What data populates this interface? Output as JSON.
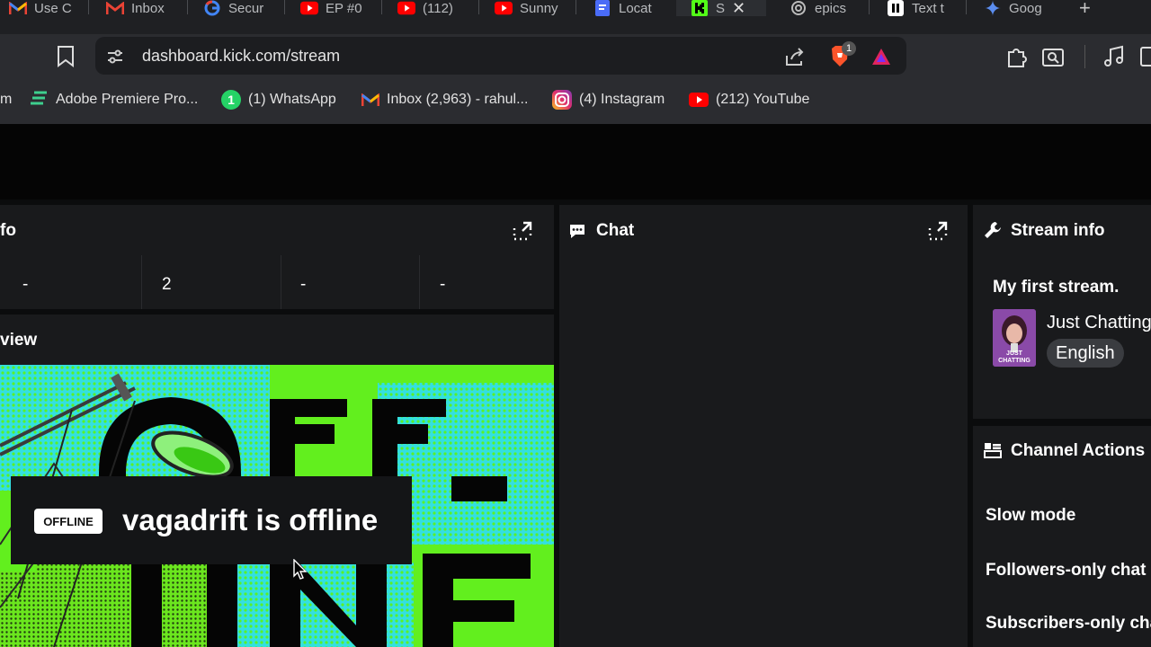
{
  "browser": {
    "tabs": [
      {
        "label": "Use C",
        "icon": "gmail-icon"
      },
      {
        "label": "Inbox",
        "icon": "gmail-icon"
      },
      {
        "label": "Secur",
        "icon": "google-icon"
      },
      {
        "label": "EP #0",
        "icon": "youtube-icon"
      },
      {
        "label": "(112)",
        "icon": "youtube-icon"
      },
      {
        "label": "Sunny",
        "icon": "youtube-icon"
      },
      {
        "label": "Locat",
        "icon": "forms-icon"
      },
      {
        "label": "S",
        "icon": "kick-icon",
        "active": true
      },
      {
        "label": "epics",
        "icon": "openai-icon"
      },
      {
        "label": "Text t",
        "icon": "pause-icon"
      },
      {
        "label": "Goog",
        "icon": "gemini-icon"
      }
    ],
    "url": "dashboard.kick.com/stream",
    "shield_count": "1",
    "bookmarks": [
      {
        "label": "Adobe Premiere Pro...",
        "icon": "premiere-icon"
      },
      {
        "label": "(1) WhatsApp",
        "icon": "whatsapp-icon",
        "badge": "1"
      },
      {
        "label": "Inbox (2,963) - rahul...",
        "icon": "gmail-icon"
      },
      {
        "label": "(4) Instagram",
        "icon": "instagram-icon"
      },
      {
        "label": "(212) YouTube",
        "icon": "youtube-icon"
      }
    ],
    "bookmark_partial": "m"
  },
  "dashboard": {
    "session_panel": {
      "title_partial": "fo",
      "stats": [
        "-",
        "2",
        "-",
        "-"
      ]
    },
    "preview_panel": {
      "title_partial": "view",
      "offline_badge": "OFFLINE",
      "offline_message": "vagadrift is offline"
    },
    "chat_panel": {
      "title": "Chat"
    },
    "stream_info": {
      "title": "Stream info",
      "stream_title": "My first stream.",
      "category": "Just Chatting",
      "thumbnail_text": "JUST CHATTING",
      "language": "English"
    },
    "channel_actions": {
      "title": "Channel Actions",
      "items": [
        "Slow mode",
        "Followers-only chat",
        "Subscribers-only chat"
      ]
    }
  },
  "colors": {
    "accent_green": "#53fc18",
    "panel": "#191a1c",
    "background": "#0b0c0d"
  }
}
